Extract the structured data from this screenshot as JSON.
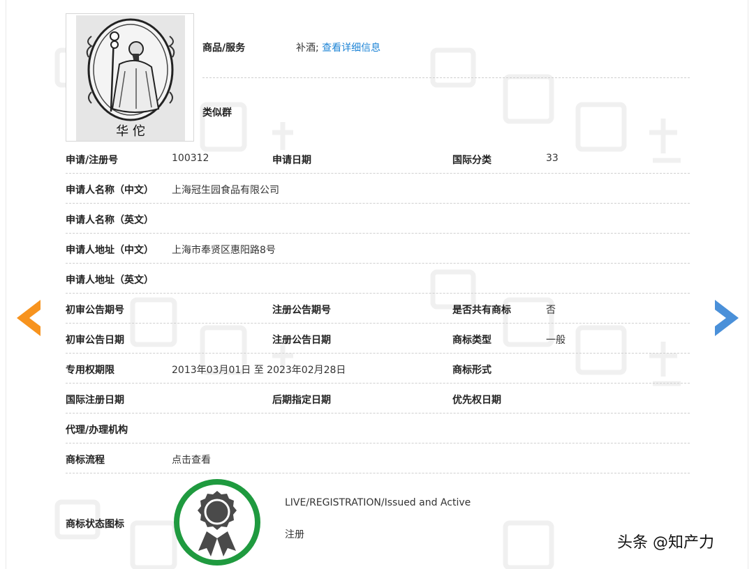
{
  "top": {
    "goods_label": "商品/服务",
    "goods_value": "补酒;",
    "goods_link": "查看详细信息",
    "similar_group_label": "类似群"
  },
  "trademark_image": {
    "caption": "华 佗"
  },
  "rows": {
    "reg_no_label": "申请/注册号",
    "reg_no_value": "100312",
    "app_date_label": "申请日期",
    "intl_class_label": "国际分类",
    "intl_class_value": "33",
    "applicant_cn_label": "申请人名称（中文）",
    "applicant_cn_value": "上海冠生园食品有限公司",
    "applicant_en_label": "申请人名称（英文）",
    "address_cn_label": "申请人地址（中文）",
    "address_cn_value": "上海市奉贤区惠阳路8号",
    "address_en_label": "申请人地址（英文）",
    "prelim_pub_no_label": "初审公告期号",
    "reg_pub_no_label": "注册公告期号",
    "shared_label": "是否共有商标",
    "shared_value": "否",
    "prelim_pub_date_label": "初审公告日期",
    "reg_pub_date_label": "注册公告日期",
    "tm_type_label": "商标类型",
    "tm_type_value": "一般",
    "exclusive_period_label": "专用权期限",
    "exclusive_period_value": "2013年03月01日 至 2023年02月28日",
    "tm_form_label": "商标形式",
    "intl_reg_date_label": "国际注册日期",
    "later_designation_label": "后期指定日期",
    "priority_date_label": "优先权日期",
    "agent_label": "代理/办理机构",
    "process_label": "商标流程",
    "process_link": "点击查看",
    "status_icon_label": "商标状态图标"
  },
  "status": {
    "english": "LIVE/REGISTRATION/Issued and Active",
    "chinese": "注册"
  },
  "attribution": {
    "text": "头条 @知产力"
  },
  "colors": {
    "link": "#1e84d6",
    "prev_arrow": "#f7931e",
    "next_arrow": "#4a90d9",
    "badge_ring": "#1f9a3f",
    "badge_seal": "#4a4a4a"
  },
  "icons": {
    "prev": "arrow-left-icon",
    "next": "arrow-right-icon",
    "status": "registered-seal-icon"
  }
}
